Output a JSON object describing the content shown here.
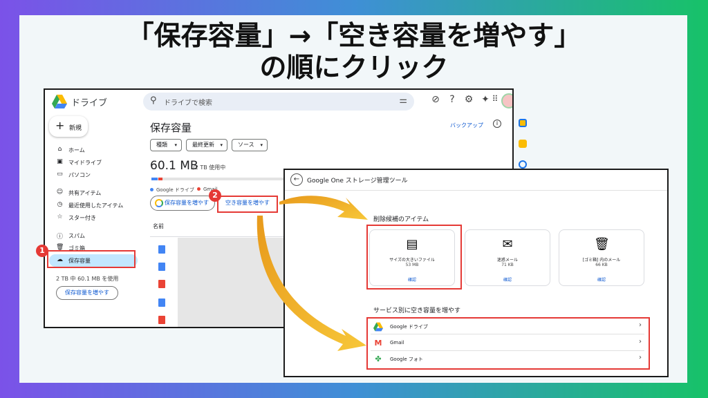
{
  "headline": {
    "line1": "「保存容量」→「空き容量を増やす」",
    "line2": "の順にクリック"
  },
  "drive": {
    "app_title": "ドライブ",
    "search_placeholder": "ドライブで検索",
    "new_label": "新規",
    "nav": [
      {
        "icon": "home-icon",
        "label": "ホーム"
      },
      {
        "icon": "my-drive-icon",
        "label": "マイドライブ"
      },
      {
        "icon": "computer-icon",
        "label": "パソコン"
      },
      {
        "icon": "shared-icon",
        "label": "共有アイテム"
      },
      {
        "icon": "clock-icon",
        "label": "最近使用したアイテム"
      },
      {
        "icon": "star-icon",
        "label": "スター付き"
      },
      {
        "icon": "spam-icon",
        "label": "スパム"
      },
      {
        "icon": "trash-icon",
        "label": "ゴミ箱"
      },
      {
        "icon": "cloud-icon",
        "label": "保存容量"
      }
    ],
    "quota_text": "2 TB 中 60.1 MB を使用",
    "increase_btn": "保存容量を増やす",
    "main": {
      "title": "保存容量",
      "backup": "バックアップ",
      "filters": [
        "種類",
        "最終更新",
        "ソース"
      ],
      "usage_big": "60.1 MB",
      "usage_small": "/2 TB 使用中",
      "legend": [
        "Google ドライブ",
        "Gmail"
      ],
      "btn_increase": "保存容量を増やす",
      "btn_free": "空き容量を増やす",
      "name_header": "名前"
    }
  },
  "badges": {
    "one": "1",
    "two": "2"
  },
  "one": {
    "title": "Google One ストレージ管理ツール",
    "section_candidates": "削除候補のアイテム",
    "candidates": [
      {
        "icon": "large-file-icon",
        "name": "サイズの大きいファイル",
        "size": "53 MB",
        "action": "確認"
      },
      {
        "icon": "spam-mail-icon",
        "name": "迷惑メール",
        "size": "71 KB",
        "action": "確認"
      },
      {
        "icon": "trash-icon",
        "name": "[ゴミ箱] 内のメール",
        "size": "66 KB",
        "action": "確認"
      }
    ],
    "section_services": "サービス別に空き容量を増やす",
    "services": [
      {
        "icon": "google-drive-icon",
        "name": "Google ドライブ"
      },
      {
        "icon": "gmail-icon",
        "name": "Gmail"
      },
      {
        "icon": "google-photos-icon",
        "name": "Google フォト"
      }
    ]
  },
  "colors": {
    "accent_red": "#e53935",
    "arrow": "#f5a623",
    "link_blue": "#0b57d0"
  }
}
